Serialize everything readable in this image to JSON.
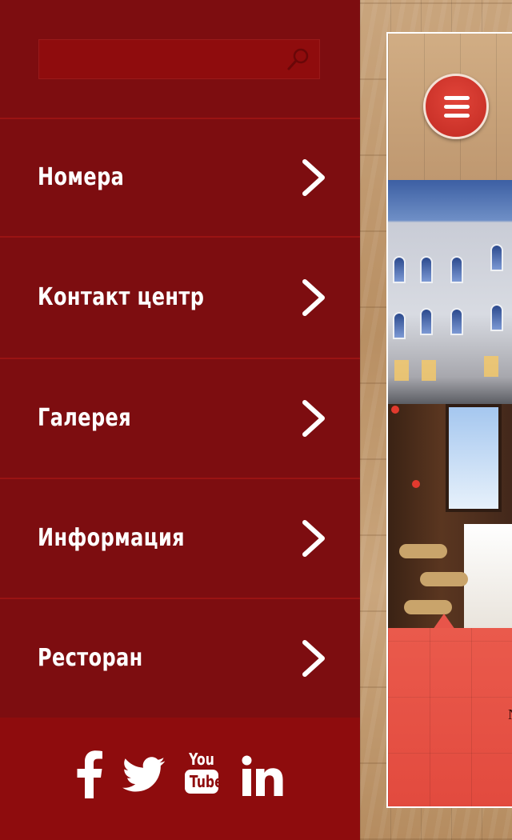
{
  "search": {
    "placeholder": "",
    "value": ""
  },
  "menu": {
    "items": [
      {
        "label": "Номера"
      },
      {
        "label": "Контакт центр"
      },
      {
        "label": "Галерея"
      },
      {
        "label": "Информация"
      },
      {
        "label": "Ресторан"
      }
    ]
  },
  "social": {
    "youtube_top": "You",
    "youtube_bottom": "Tube",
    "linkedin": "in",
    "icons": [
      "facebook-icon",
      "twitter-icon",
      "youtube-icon",
      "linkedin-icon"
    ]
  },
  "preview": {
    "partial_text": "N"
  },
  "colors": {
    "drawer_bg": "#7d0d10",
    "search_bg": "#8f0c0d",
    "social_bg": "#8e0c0d",
    "accent_red": "#e24a3e",
    "divider": "#9a1313",
    "text": "#ffffff"
  }
}
